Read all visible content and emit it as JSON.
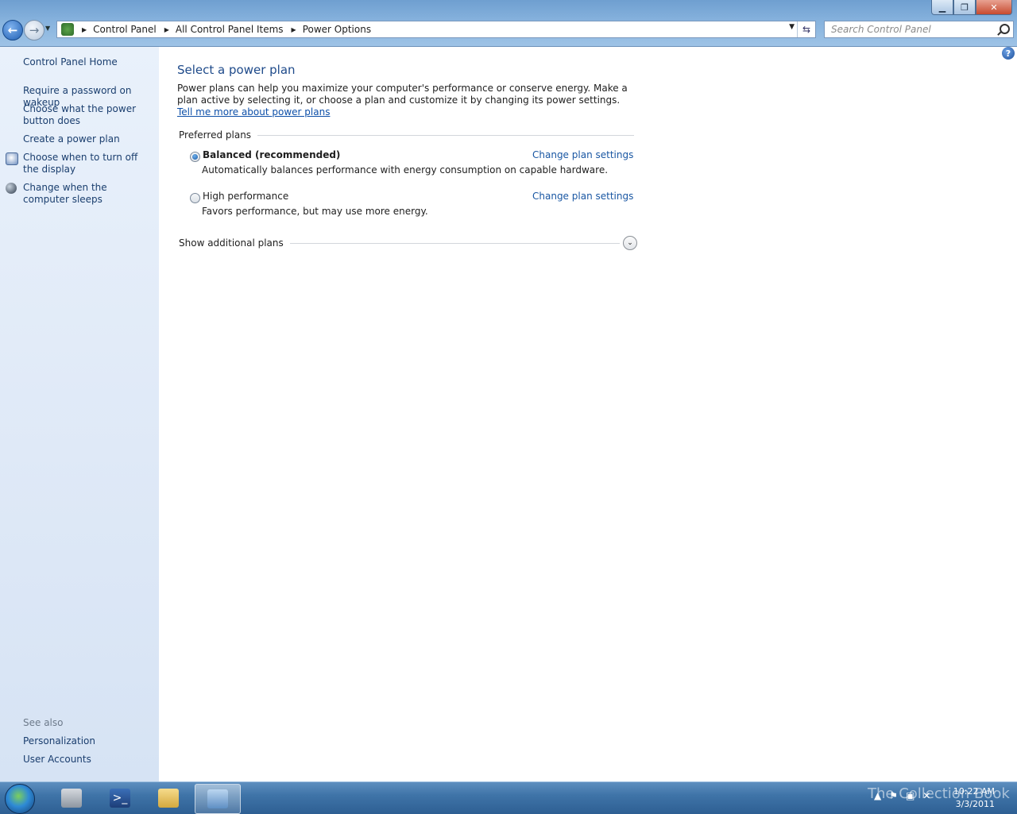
{
  "address_bar": {
    "breadcrumbs": [
      "Control Panel",
      "All Control Panel Items",
      "Power Options"
    ],
    "search_placeholder": "Search Control Panel"
  },
  "left_pane": {
    "home": "Control Panel Home",
    "links": [
      "Require a password on wakeup",
      "Choose what the power button does",
      "Create a power plan",
      "Choose when to turn off the display",
      "Change when the computer sleeps"
    ],
    "see_also_label": "See also",
    "see_also": [
      "Personalization",
      "User Accounts"
    ]
  },
  "main": {
    "title": "Select a power plan",
    "intro": "Power plans can help you maximize your computer's performance or conserve energy. Make a plan active by selecting it, or choose a plan and customize it by changing its power settings.",
    "intro_link": "Tell me more about power plans",
    "preferred_label": "Preferred plans",
    "plans": [
      {
        "name": "Balanced (recommended)",
        "description": "Automatically balances performance with energy consumption on capable hardware.",
        "selected": true,
        "link": "Change plan settings"
      },
      {
        "name": "High performance",
        "description": "Favors performance, but may use more energy.",
        "selected": false,
        "link": "Change plan settings"
      }
    ],
    "additional_label": "Show additional plans"
  },
  "taskbar": {
    "clock_time": "10:22 AM",
    "clock_date": "3/3/2011",
    "watermark": "The Collection Book"
  },
  "colors": {
    "link": "#1a3e6e",
    "title": "#1e4a8a",
    "taskbar": "#3f74a8"
  }
}
